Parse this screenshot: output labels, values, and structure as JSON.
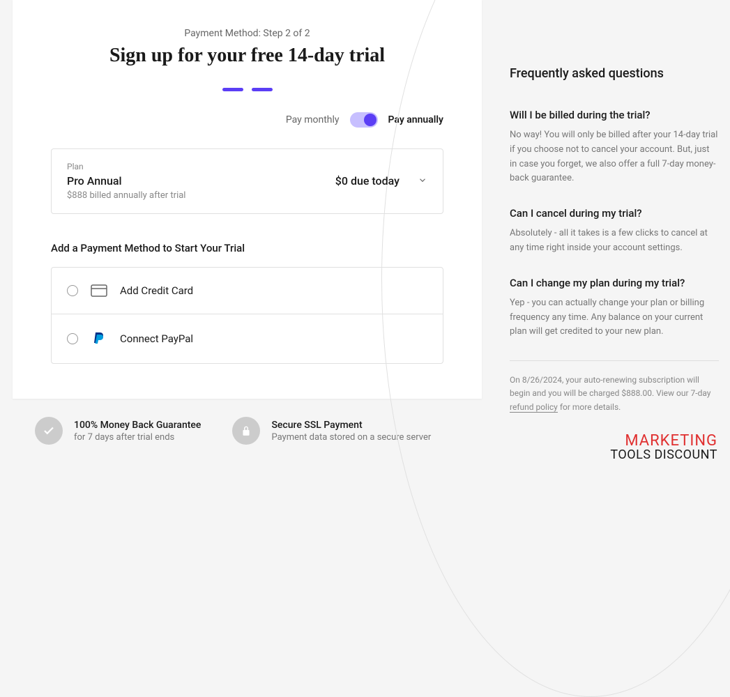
{
  "header": {
    "step_text": "Payment Method: Step 2 of 2",
    "title": "Sign up for your free 14-day trial"
  },
  "billing_toggle": {
    "monthly_label": "Pay monthly",
    "annually_label": "Pay annually"
  },
  "plan": {
    "label": "Plan",
    "name": "Pro Annual",
    "price_today": "$0 due today",
    "sub": "$888 billed annually after trial"
  },
  "payment": {
    "section_title": "Add a Payment Method to Start Your Trial",
    "credit_card": "Add Credit Card",
    "paypal": "Connect PayPal"
  },
  "badges": {
    "guarantee": {
      "title": "100% Money Back Guarantee",
      "sub": "for 7 days after trial ends"
    },
    "ssl": {
      "title": "Secure SSL Payment",
      "sub": "Payment data stored on a secure server"
    }
  },
  "faq": {
    "title": "Frequently asked questions",
    "items": [
      {
        "q": "Will I be billed during the trial?",
        "a": "No way! You will only be billed after your 14-day trial if you choose not to cancel your account. But, just in case you forget, we also offer a full 7-day money-back guarantee."
      },
      {
        "q": "Can I cancel during my trial?",
        "a": "Absolutely - all it takes is a few clicks to cancel at any time right inside your account settings."
      },
      {
        "q": "Can I change my plan during my trial?",
        "a": "Yep - you can actually change your plan or billing frequency any time. Any balance on your current plan will get credited to your new plan."
      }
    ]
  },
  "fine_print": {
    "text_before": "On 8/26/2024, your auto-renewing subscription will begin and you will be charged $888.00. View our 7-day ",
    "link": "refund policy",
    "text_after": " for more details."
  },
  "logo": {
    "top": "MARKETING",
    "bottom": "TOOLS DISCOUNT"
  }
}
